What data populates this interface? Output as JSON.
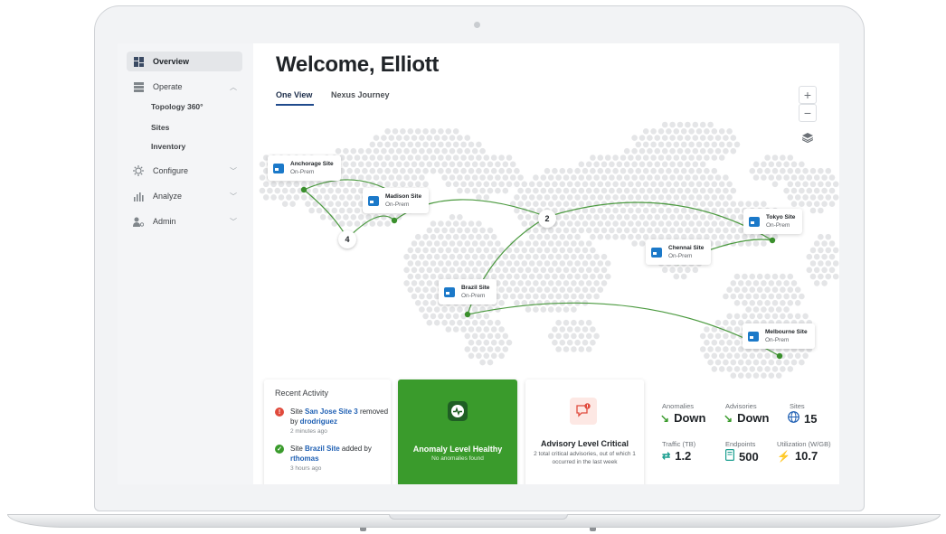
{
  "sidebar": {
    "items": [
      {
        "label": "Overview",
        "icon": "dashboard-icon"
      },
      {
        "label": "Operate",
        "icon": "server-icon"
      },
      {
        "label": "Configure",
        "icon": "gear-icon"
      },
      {
        "label": "Analyze",
        "icon": "bar-chart-icon"
      },
      {
        "label": "Admin",
        "icon": "user-settings-icon"
      }
    ],
    "operate_sub": [
      "Topology 360°",
      "Sites",
      "Inventory"
    ]
  },
  "header": {
    "title": "Welcome, Elliott"
  },
  "tabs": [
    "One View",
    "Nexus Journey"
  ],
  "map": {
    "sites": [
      {
        "name": "Anchorage Site",
        "type": "On-Prem"
      },
      {
        "name": "Madison Site",
        "type": "On-Prem"
      },
      {
        "name": "Tokyo Site",
        "type": "On-Prem"
      },
      {
        "name": "Chennai Site",
        "type": "On-Prem"
      },
      {
        "name": "Brazil Site",
        "type": "On-Prem"
      },
      {
        "name": "Melbourne Site",
        "type": "On-Prem"
      }
    ],
    "clusters": [
      "4",
      "2"
    ],
    "controls": {
      "zoom_in": "+",
      "zoom_out": "−"
    }
  },
  "recent_activity": {
    "title": "Recent Activity",
    "items": [
      {
        "pre": "Site ",
        "site": "San Jose Site 3",
        "mid": " removed by ",
        "user": "drodriguez",
        "time": "2 minutes ago",
        "status": "error"
      },
      {
        "pre": "Site ",
        "site": "Brazil Site",
        "mid": " added by ",
        "user": "rthomas",
        "time": "3 hours ago",
        "status": "success"
      }
    ]
  },
  "anomaly": {
    "title": "Anomaly Level Healthy",
    "subtitle": "No anomalies found"
  },
  "advisory": {
    "title": "Advisory Level Critical",
    "subtitle": "2 total critical advisories, out of which 1 occurred in the last week"
  },
  "stats": {
    "anomalies": {
      "label": "Anomalies",
      "value": "Down"
    },
    "advisories": {
      "label": "Advisories",
      "value": "Down"
    },
    "sites": {
      "label": "Sites",
      "value": "15"
    },
    "traffic": {
      "label": "Traffic (TB)",
      "value": "1.2"
    },
    "endpoints": {
      "label": "Endpoints",
      "value": "500"
    },
    "utilization": {
      "label": "Utilization (W/GB)",
      "value": "10.7"
    }
  },
  "colors": {
    "accent_green": "#3a9b2c",
    "link_blue": "#1e5fb3",
    "site_icon_blue": "#1b79c9",
    "critical_red": "#e04a3c",
    "lightning_yellow": "#f5b400",
    "teal": "#1a9e8f"
  }
}
